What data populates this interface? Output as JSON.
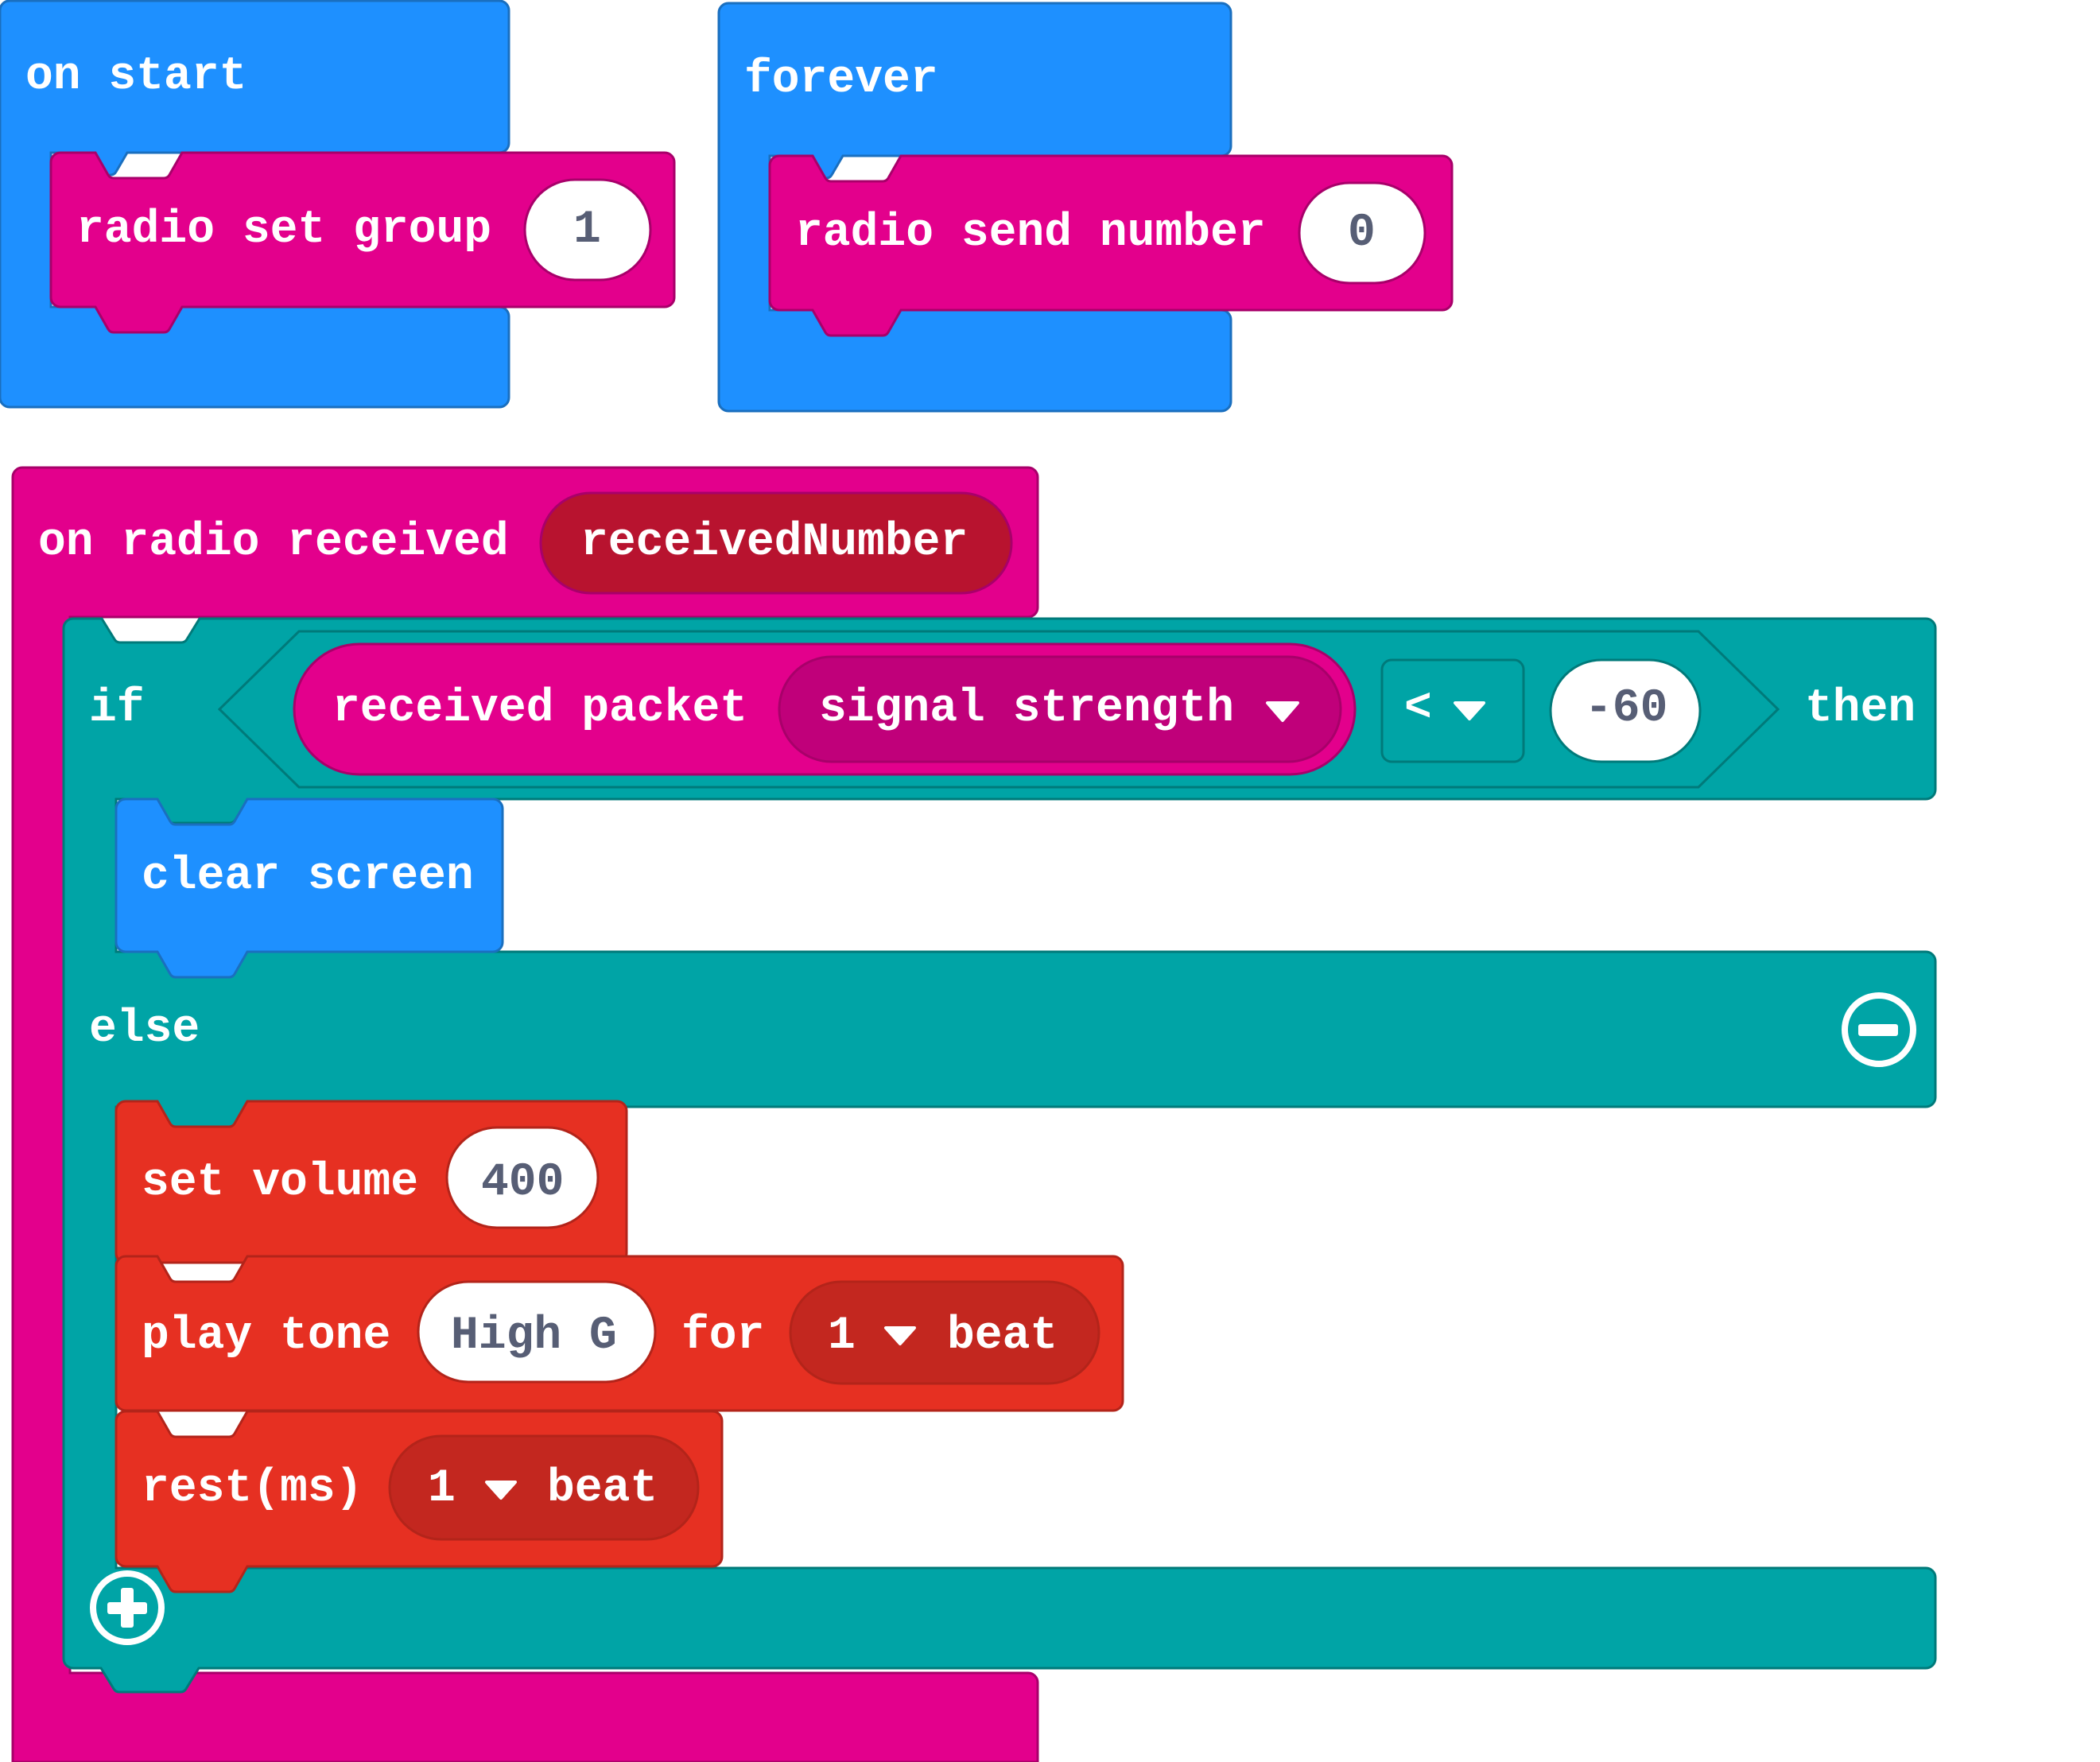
{
  "workspace": {
    "colors": {
      "events_blue": "#1E90FF",
      "radio_pink": "#E3008C",
      "logic_teal": "#00A4A6",
      "music_red": "#E63022",
      "variable_red": "#B8132F",
      "value_text": "#575E75"
    },
    "on_start": {
      "label": "on start",
      "children": [
        {
          "label": "radio set group",
          "value": "1"
        }
      ]
    },
    "forever": {
      "label": "forever",
      "children": [
        {
          "label": "radio send number",
          "value": "0"
        }
      ]
    },
    "on_radio_received": {
      "label": "on radio received",
      "variable": "receivedNumber",
      "if_block": {
        "if_label": "if",
        "then_label": "then",
        "else_label": "else",
        "condition": {
          "left_label": "received packet",
          "left_dropdown": "signal strength",
          "operator": "<",
          "right_value": "-60"
        },
        "then_children": [
          {
            "label": "clear screen"
          }
        ],
        "else_children": [
          {
            "label": "set volume",
            "value": "400"
          },
          {
            "label": "play tone",
            "note": "High G",
            "for_label": "for",
            "beats": "1",
            "beat_unit": "beat"
          },
          {
            "label": "rest(ms)",
            "beats": "1",
            "beat_unit": "beat"
          }
        ],
        "remove_else_icon": "minus-circle-icon",
        "add_else_icon": "plus-circle-icon"
      }
    }
  }
}
